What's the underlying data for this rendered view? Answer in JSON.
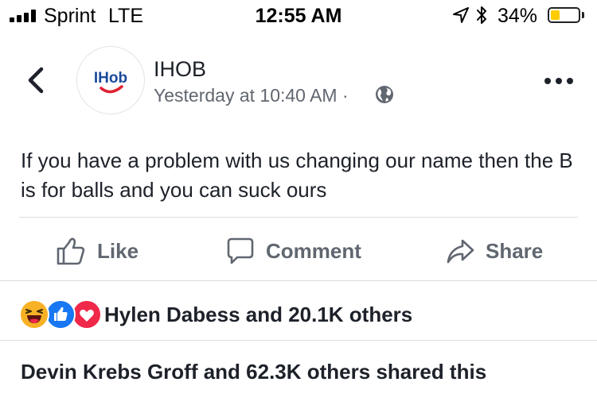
{
  "status_bar": {
    "carrier": "Sprint",
    "network": "LTE",
    "time": "12:55 AM",
    "battery_percent": "34%",
    "battery_level": 0.34,
    "icons": [
      "signal-icon",
      "location-arrow-icon",
      "bluetooth-icon",
      "battery-icon"
    ]
  },
  "post": {
    "page_name": "IHOB",
    "avatar_logo_text": "IHob",
    "timestamp": "Yesterday at 10:40 AM",
    "separator": "·",
    "privacy_icon": "globe-icon",
    "text": "If you have a problem with us changing our name then the B is for balls and you can suck ours"
  },
  "actions": {
    "like_label": "Like",
    "comment_label": "Comment",
    "share_label": "Share"
  },
  "reactions": {
    "icons": [
      "haha-icon",
      "like-reaction-icon",
      "love-icon"
    ],
    "summary": "Hylen Dabess and 20.1K others"
  },
  "shares": {
    "summary": "Devin Krebs Groff and 62.3K others shared this"
  },
  "colors": {
    "facebook_blue": "#1877f2",
    "love_red": "#f0284a",
    "haha_yellow": "#f7b125",
    "ihob_blue": "#1b4a9a",
    "ihob_red": "#e02131",
    "battery_yellow": "#ffcc00"
  }
}
